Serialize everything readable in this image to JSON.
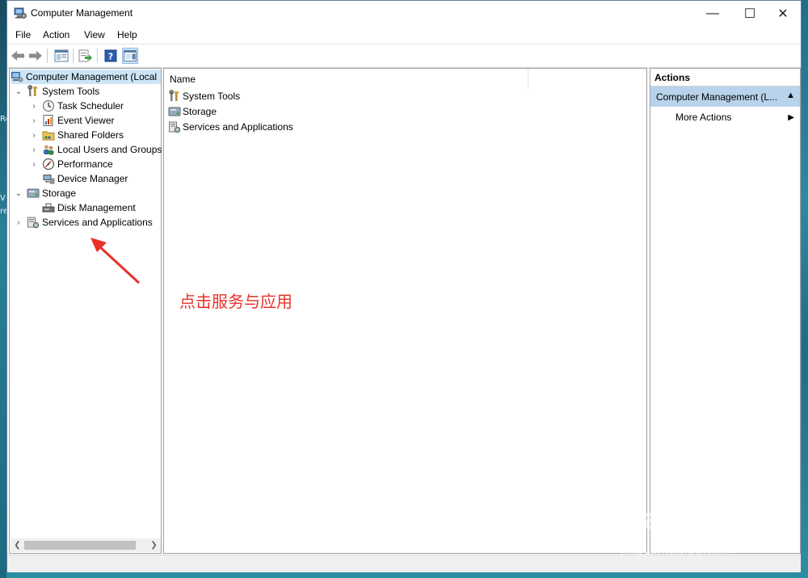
{
  "desktop": {
    "left_chars": [
      "Re",
      "V",
      "re"
    ]
  },
  "window": {
    "title": "Computer Management",
    "controls": {
      "minimize": "—",
      "maximize": "☐",
      "close": "✕"
    }
  },
  "menu": {
    "file": "File",
    "action": "Action",
    "view": "View",
    "help": "Help"
  },
  "tree": {
    "root": "Computer Management (Local",
    "system_tools": "System Tools",
    "task_scheduler": "Task Scheduler",
    "event_viewer": "Event Viewer",
    "shared_folders": "Shared Folders",
    "local_users": "Local Users and Groups",
    "performance": "Performance",
    "device_manager": "Device Manager",
    "storage": "Storage",
    "disk_management": "Disk Management",
    "services": "Services and Applications"
  },
  "list": {
    "header_name": "Name",
    "items": [
      "System Tools",
      "Storage",
      "Services and Applications"
    ]
  },
  "actions": {
    "title": "Actions",
    "selected": "Computer Management (L...",
    "more": "More Actions"
  },
  "annotation": {
    "text": "点击服务与应用",
    "color": "#e8322a"
  },
  "watermark": {
    "brand": "Bai",
    "brand2": "du",
    "cn": "经验",
    "url": "jingyan.baidu.com"
  },
  "colors": {
    "selection": "#cde6f7",
    "actions_selected": "#b8d3eb",
    "accent": "#1a5fa8"
  }
}
